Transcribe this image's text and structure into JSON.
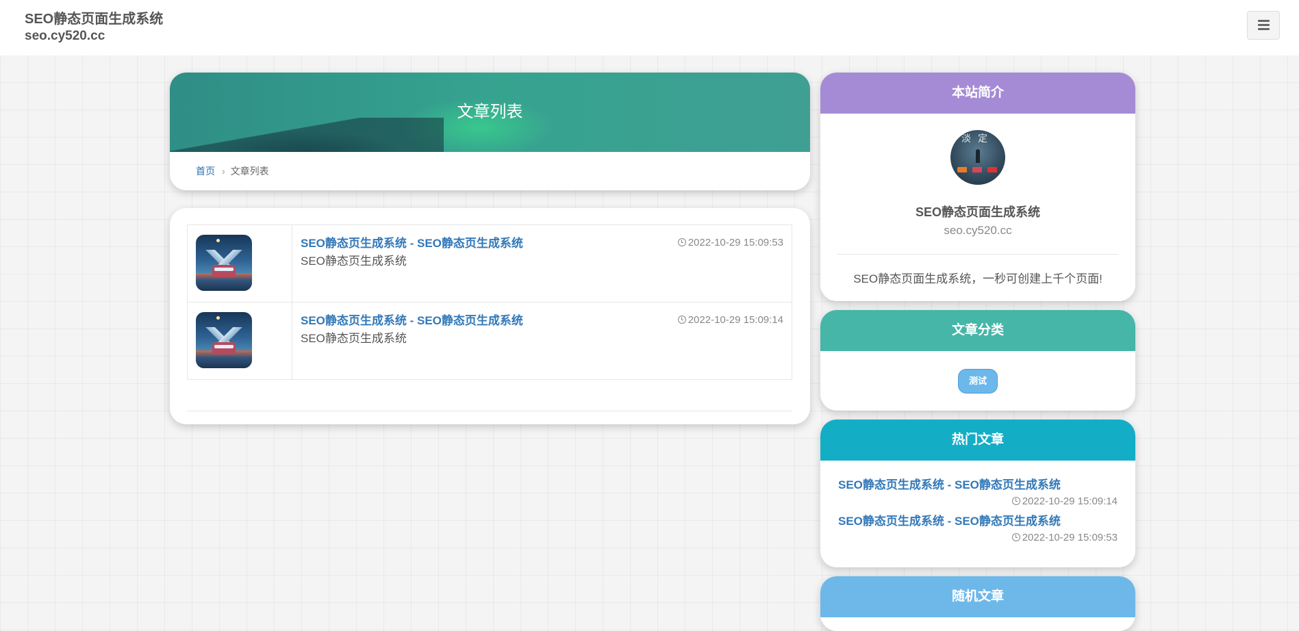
{
  "header": {
    "site_title": "SEO静态页面生成系统",
    "site_domain": "seo.cy520.cc",
    "menu_icon": "menu-icon"
  },
  "banner": {
    "title": "文章列表"
  },
  "breadcrumb": {
    "home": "首页",
    "separator": "›",
    "current": "文章列表"
  },
  "articles": [
    {
      "title": "SEO静态页生成系统 - SEO静态页生成系统",
      "description": "SEO静态页生成系统",
      "date": "2022-10-29 15:09:53"
    },
    {
      "title": "SEO静态页生成系统 - SEO静态页生成系统",
      "description": "SEO静态页生成系统",
      "date": "2022-10-29 15:09:14"
    }
  ],
  "sidebar": {
    "about": {
      "heading": "本站简介",
      "avatar_text": "淡定",
      "name": "SEO静态页面生成系统",
      "domain": "seo.cy520.cc",
      "description": "SEO静态页面生成系统，一秒可创建上千个页面!"
    },
    "categories": {
      "heading": "文章分类",
      "tags": [
        "测试"
      ]
    },
    "hot": {
      "heading": "热门文章",
      "items": [
        {
          "title": "SEO静态页生成系统 - SEO静态页生成系统",
          "date": "2022-10-29 15:09:14"
        },
        {
          "title": "SEO静态页生成系统 - SEO静态页生成系统",
          "date": "2022-10-29 15:09:53"
        }
      ]
    },
    "random": {
      "heading": "随机文章"
    }
  },
  "colors": {
    "link": "#3278b8",
    "about_header": "#a58bd5",
    "category_header": "#46b6a8",
    "hot_header": "#14adc6",
    "random_header": "#6db8e9",
    "banner": "#36a38f",
    "tag": "#6cb8ea"
  }
}
